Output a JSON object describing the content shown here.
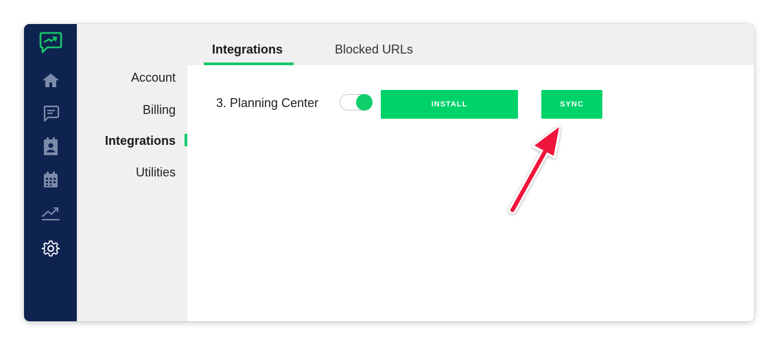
{
  "sidebar": {
    "icons": [
      "chat-bolt-logo-icon",
      "home-icon",
      "messages-icon",
      "contacts-icon",
      "calendar-icon",
      "analytics-icon",
      "settings-icon"
    ]
  },
  "subnav": {
    "items": [
      {
        "label": "Account"
      },
      {
        "label": "Billing"
      },
      {
        "label": "Integrations",
        "active": true
      },
      {
        "label": "Utilities"
      }
    ]
  },
  "tabs": [
    {
      "label": "Integrations",
      "active": true
    },
    {
      "label": "Blocked URLs"
    }
  ],
  "integration": {
    "name": "3. Planning Center",
    "enabled": true,
    "install_label": "INSTALL",
    "sync_label": "SYNC"
  },
  "colors": {
    "rail": "#0f2350",
    "accent": "#00d26a",
    "annotation_arrow": "#f0173b"
  }
}
